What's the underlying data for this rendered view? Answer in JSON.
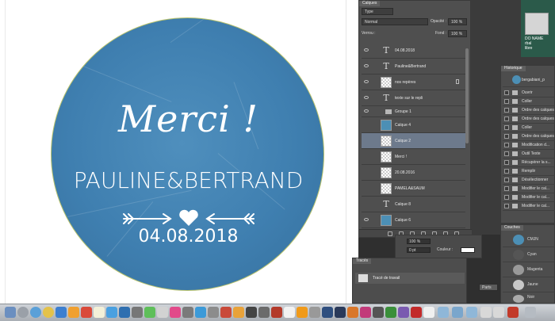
{
  "canvas": {
    "title": "Merci !",
    "names": "PAULINE&BERTRAND",
    "date": "04.08.2018"
  },
  "layers_panel": {
    "tab": "Calques",
    "filter": "Type",
    "blend_mode": "Normal",
    "opacity_label": "Opacité :",
    "opacity_value": "100 %",
    "lock_label": "Verrou :",
    "fill_label": "Fond :",
    "fill_value": "100 %",
    "layers": [
      {
        "name": "04.08.2018",
        "kind": "text"
      },
      {
        "name": "Pauline&Bertrand",
        "kind": "text"
      },
      {
        "name": "nos repères",
        "kind": "raster",
        "locked": true
      },
      {
        "name": "texte sur le repli",
        "kind": "text"
      },
      {
        "name": "Groupe 1",
        "kind": "group"
      },
      {
        "name": "Calque 4",
        "kind": "raster"
      },
      {
        "name": "Calque 2",
        "kind": "raster",
        "selected": true
      },
      {
        "name": "Merci !",
        "kind": "raster"
      },
      {
        "name": "20.08.2016",
        "kind": "raster"
      },
      {
        "name": "PAMELA&SAUM",
        "kind": "raster"
      },
      {
        "name": "Calque 8",
        "kind": "text"
      },
      {
        "name": "Calque 6",
        "kind": "raster"
      }
    ]
  },
  "history_panel": {
    "tab": "Historique",
    "snapshot": "bergabiani_p",
    "items": [
      "Ouvrir",
      "Coller",
      "Ordre des calques",
      "Ordre des calques",
      "Coller",
      "Ordre des calques",
      "Modification d...",
      "Outil Texte",
      "Récupérer la s...",
      "Remplir",
      "Désélectionner",
      "Modifier le cal...",
      "Modifier le cal...",
      "Modifier le cal..."
    ]
  },
  "channels_panel": {
    "tab": "Couches",
    "channels": [
      "CMJN",
      "Cyan",
      "Magenta",
      "Jaune",
      "Noir"
    ]
  },
  "properties_panel": {
    "zoom": "100 %",
    "offset": "0 pt",
    "color_label": "Couleur :",
    "button": "Parts"
  },
  "paths_panel": {
    "tab": "Tracés",
    "path": "Tracé de travail"
  },
  "desktop": {
    "label": "DO NAME\nrbal\nlibre"
  },
  "colors": {
    "circle": "#3f7fb0",
    "panel": "#535353",
    "selected_layer": "#6d7a8c"
  }
}
